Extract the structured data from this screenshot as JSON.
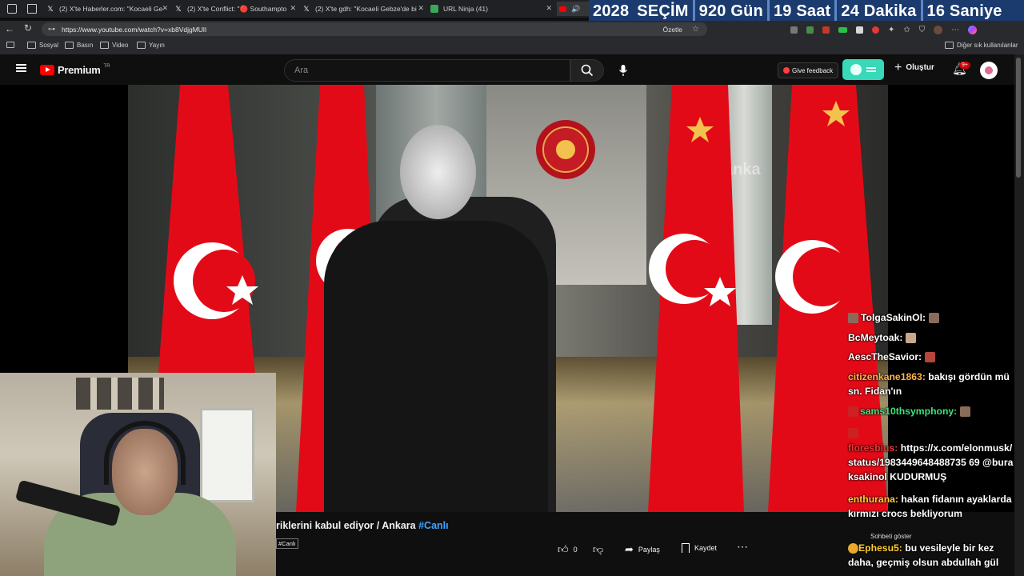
{
  "browser": {
    "tabs": [
      {
        "label": "(2) X'te Haberler.com: \"Kocaeli Ge"
      },
      {
        "label": "(2) X'te Conflict: \"🔴 Southampto"
      },
      {
        "label": "(2) X'te gdh: \"Kocaeli Gebze'de bi"
      },
      {
        "label": "URL Ninja (41)"
      }
    ],
    "url": "https://www.youtube.com/watch?v=xb8VdjgMUlI",
    "summarize_label": "Özetle",
    "bookmarks": [
      "Sosyal",
      "Basın",
      "Video",
      "Yayın"
    ],
    "other_bookmarks": "Diğer sık kullanılanlar"
  },
  "countdown": {
    "year": "2028",
    "title": "SEÇİM",
    "days": "920 Gün",
    "hours": "19 Saat",
    "minutes": "24 Dakika",
    "seconds": "16 Saniye"
  },
  "youtube": {
    "logo": "Premium",
    "region": "TR",
    "search_placeholder": "Ara",
    "feedback_label": "Give feedback",
    "create_label": "Oluştur",
    "notif_count": "9+"
  },
  "video": {
    "watermark": "anka",
    "title_visible": "riklerini kabul ediyor / Ankara",
    "hashtag": "#Canlı",
    "tag_chip": "#Canlı"
  },
  "actions": {
    "likes": "0",
    "share": "Paylaş",
    "save": "Kaydet"
  },
  "chat": {
    "show_label": "Sohbeti göster",
    "messages": [
      {
        "user": "TolgaSakinOl:",
        "text": ""
      },
      {
        "user": "BcMeytoak:",
        "text": ""
      },
      {
        "user": "AescTheSavior:",
        "text": ""
      },
      {
        "user": "citizenkane1863:",
        "text": "bakışı gördün mü sn. Fidan'ın"
      },
      {
        "user": "sams10thsymphony:",
        "text": ""
      },
      {
        "user": "floresbius:",
        "text": "https://x.com/elonmusk/status/1983449648488735 69 @buraksakinol KUDURMUŞ"
      },
      {
        "user": "enthurana:",
        "text": "hakan fidanın ayaklarda kırmızı crocs bekliyorum"
      },
      {
        "user": "Ephesu5:",
        "text": "bu vesileyle bir kez daha, geçmiş olsun abdullah gül"
      }
    ]
  },
  "colors": {
    "banner_bg": "#1b3b6f",
    "flag_red": "#e30a17",
    "yt_red": "#ff0000",
    "hashtag": "#3ea6ff"
  }
}
